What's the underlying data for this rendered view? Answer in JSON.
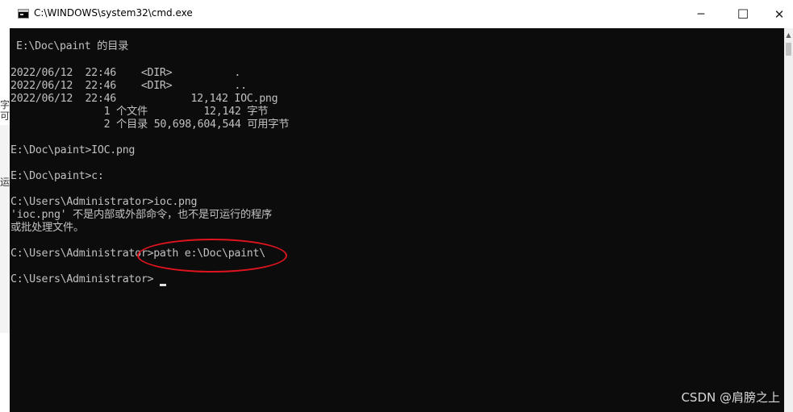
{
  "window": {
    "title": "C:\\WINDOWS\\system32\\cmd.exe",
    "icon": "console-app-icon",
    "controls": {
      "minimize": "─",
      "maximize": "☐",
      "close": "✕"
    }
  },
  "console": {
    "lines": [
      "E:\\Doc\\paint 的目录",
      "2022/06/12  22:46    <DIR>          .",
      "2022/06/12  22:46    <DIR>          ..",
      "2022/06/12  22:46            12,142 IOC.png",
      "               1 个文件         12,142 字节",
      "               2 个目录 50,698,604,544 可用字节",
      "E:\\Doc\\paint>IOC.png",
      "E:\\Doc\\paint>c:",
      "C:\\Users\\Administrator>ioc.png",
      "'ioc.png' 不是内部或外部命令，也不是可运行的程序",
      "或批处理文件。",
      "C:\\Users\\Administrator>path e:\\Doc\\paint\\",
      "C:\\Users\\Administrator>"
    ]
  },
  "background_fragments": [
    "字",
    "可",
    "运"
  ],
  "colors": {
    "console_bg": "#0c0c0c",
    "console_text": "#c0c0c0",
    "annotation": "#e0141e"
  },
  "watermark": "CSDN @肩膀之上"
}
